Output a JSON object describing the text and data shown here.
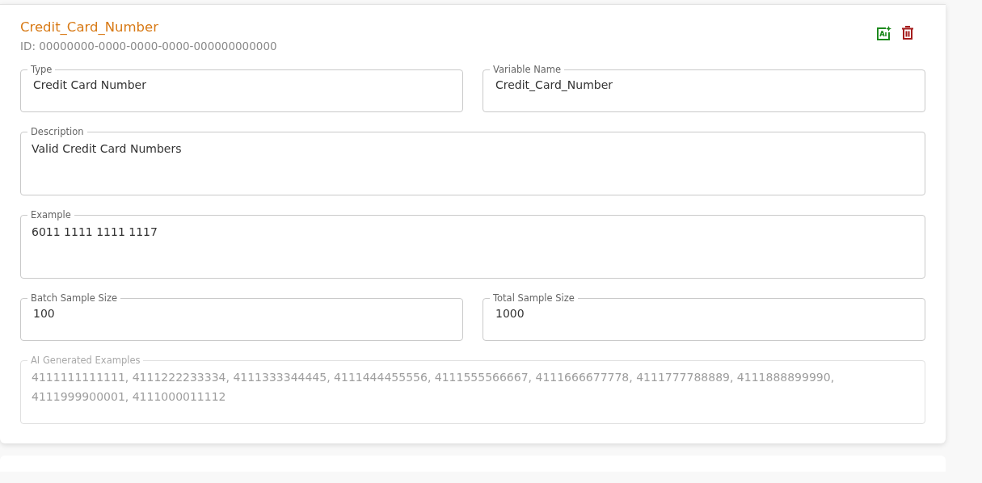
{
  "card": {
    "title": "Credit_Card_Number",
    "id_text": "ID: 00000000-0000-0000-0000-000000000000"
  },
  "fields": [
    {
      "label": "Type",
      "value": "Credit Card Number",
      "kind": "single",
      "disabled": false
    },
    {
      "label": "Variable Name",
      "value": "Credit_Card_Number",
      "kind": "single",
      "disabled": false
    },
    {
      "label": "Description",
      "value": "Valid Credit Card Numbers",
      "kind": "multiline",
      "disabled": false
    },
    {
      "label": "Example",
      "value": "6011 1111 1111 1117",
      "kind": "multiline",
      "disabled": false
    },
    {
      "label": "Batch Sample Size",
      "value": "100",
      "kind": "single",
      "disabled": false
    },
    {
      "label": "Total Sample Size",
      "value": "1000",
      "kind": "single",
      "disabled": false
    },
    {
      "label": "AI Generated Examples",
      "value": "4111111111111, 4111222233334, 4111333344445, 4111444455556, 4111555566667, 4111666677778, 4111777788889, 4111888899990, 4111999900001, 4111000011112",
      "kind": "multiline",
      "disabled": true
    }
  ]
}
